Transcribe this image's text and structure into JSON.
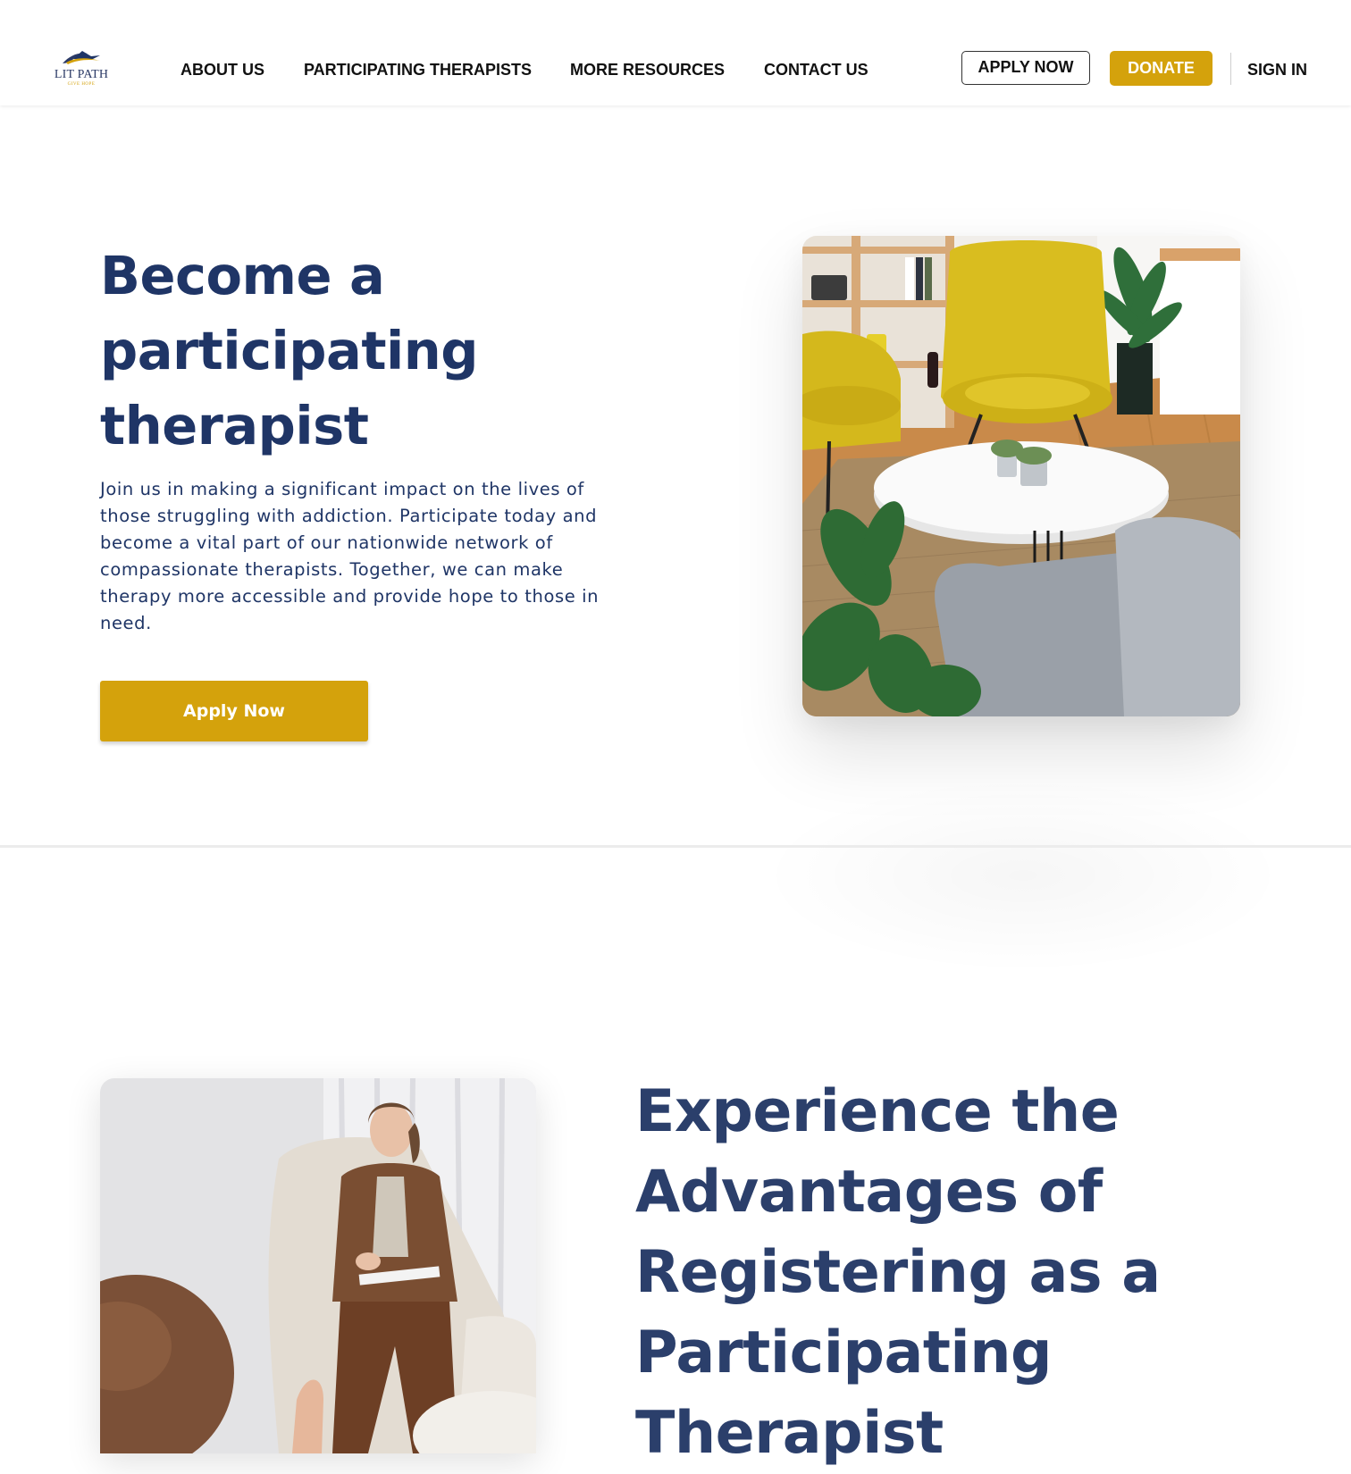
{
  "brand": {
    "name": "LIT PATH",
    "tagline": "GIVE HOPE",
    "logo_icon": "mountain-swoosh-logo",
    "accent_color": "#d4a20c",
    "primary_color": "#1f3566"
  },
  "header": {
    "nav": [
      {
        "label": "ABOUT US"
      },
      {
        "label": "PARTICIPATING THERAPISTS"
      },
      {
        "label": "MORE RESOURCES"
      },
      {
        "label": "CONTACT US"
      }
    ],
    "apply_label": "APPLY NOW",
    "donate_label": "DONATE",
    "signin_label": "SIGN IN"
  },
  "hero": {
    "title": "Become a participating therapist",
    "text": "Join us in making a significant impact on the lives of those struggling with addiction. Participate today and become a vital part of our nationwide network of compassionate therapists. Together, we can make therapy more accessible and provide hope to those in need.",
    "button_label": "Apply Now",
    "image_icon": "therapy-room-photo"
  },
  "advantages": {
    "title": "Experience the Advantages of Registering as a Participating Therapist",
    "image_icon": "therapy-session-photo"
  }
}
